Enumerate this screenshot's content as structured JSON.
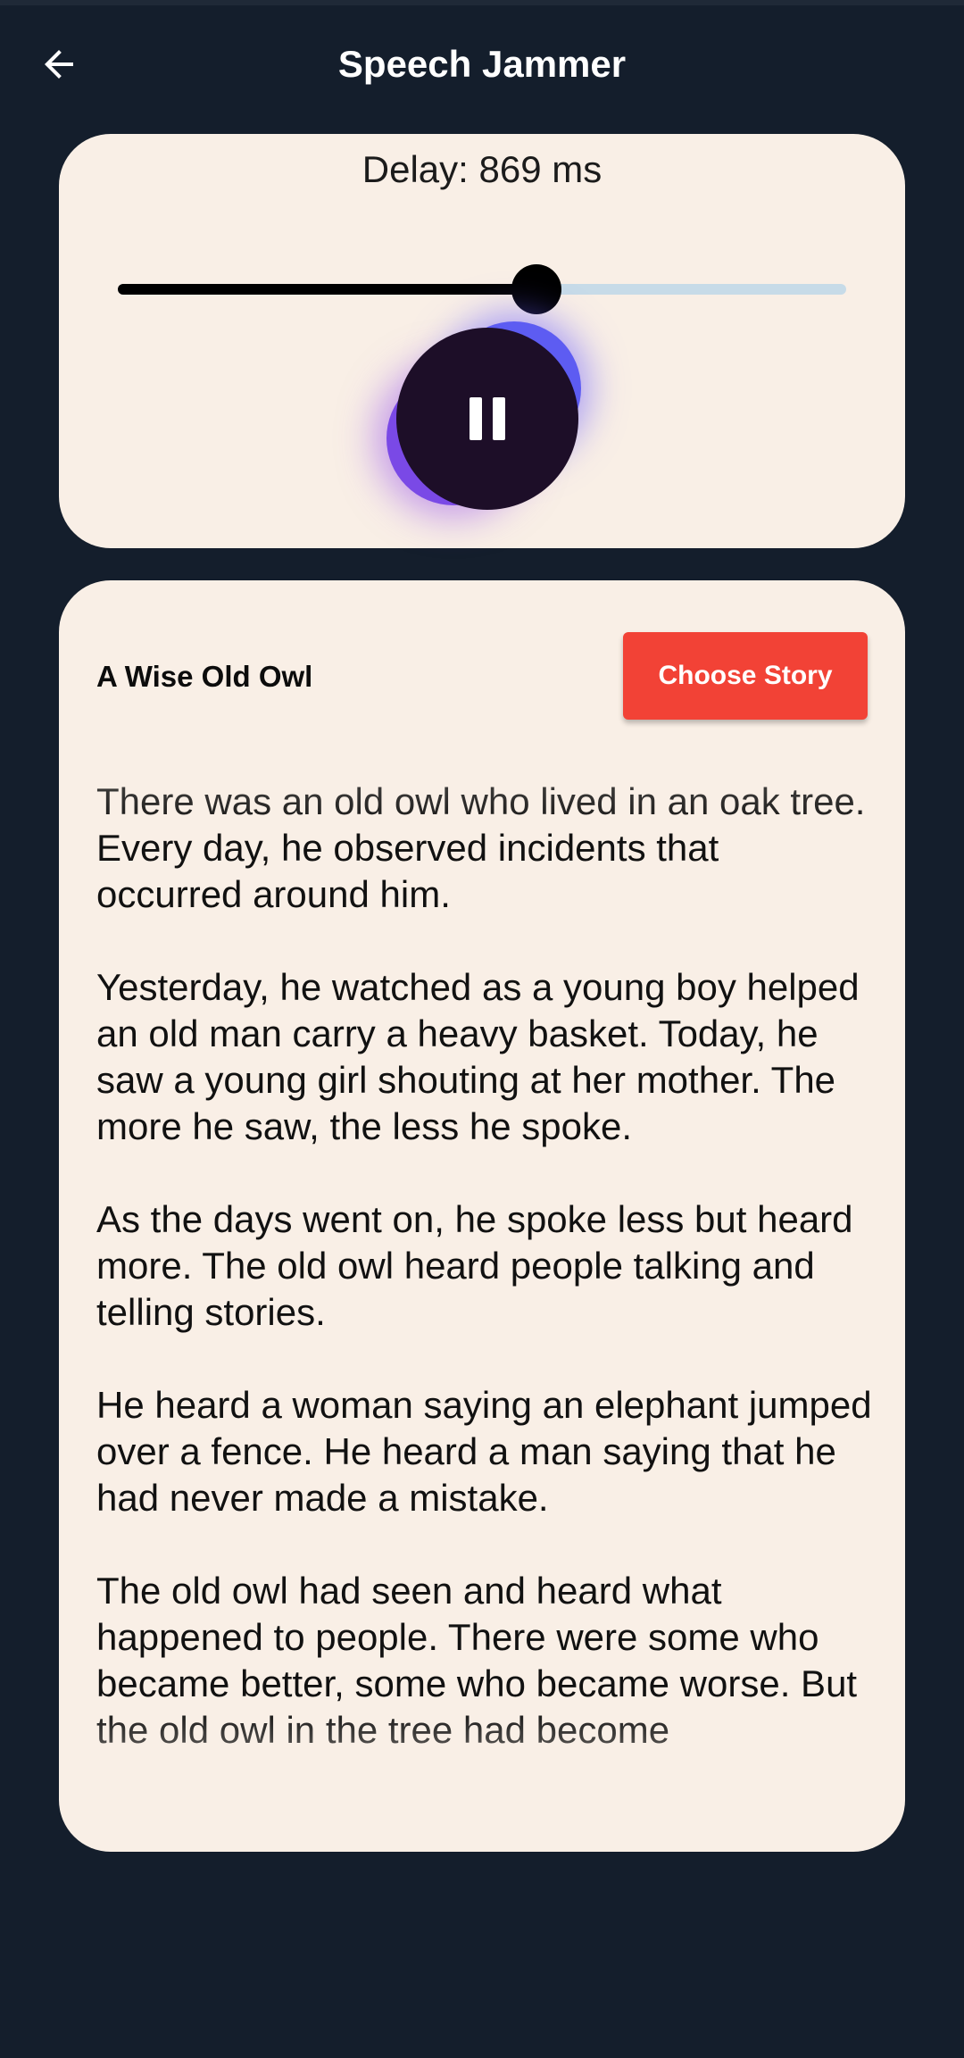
{
  "app_bar": {
    "title": "Speech Jammer",
    "back_icon": "arrow-left-icon"
  },
  "controls": {
    "delay_text": "Delay: 869 ms",
    "delay_ms": 869,
    "slider_fraction": 0.575,
    "slider_colors": {
      "active": "#000000",
      "inactive": "#c7dbe8"
    },
    "play_state": "paused",
    "pause_icon": "pause-icon"
  },
  "story": {
    "title": "A Wise Old Owl",
    "choose_label": "Choose Story",
    "paragraphs": [
      "There was an old owl who lived in an oak tree. Every day, he observed incidents that occurred around him.",
      "Yesterday, he watched as a young boy helped an old man carry a heavy basket. Today, he saw a young girl shouting at her mother. The more he saw, the less he spoke.",
      "As the days went on, he spoke less but heard more. The old owl heard people talking and telling stories.",
      "He heard a woman saying an elephant jumped over a fence. He heard a man saying that he had never made a mistake.",
      "The old owl had seen and heard what happened to people. There were some who became better, some who became worse. But the old owl in the tree had become"
    ]
  },
  "colors": {
    "background": "#141e2c",
    "card": "#f9efe6",
    "accent_button": "#f24236",
    "pause_button": "#1d0e28"
  }
}
